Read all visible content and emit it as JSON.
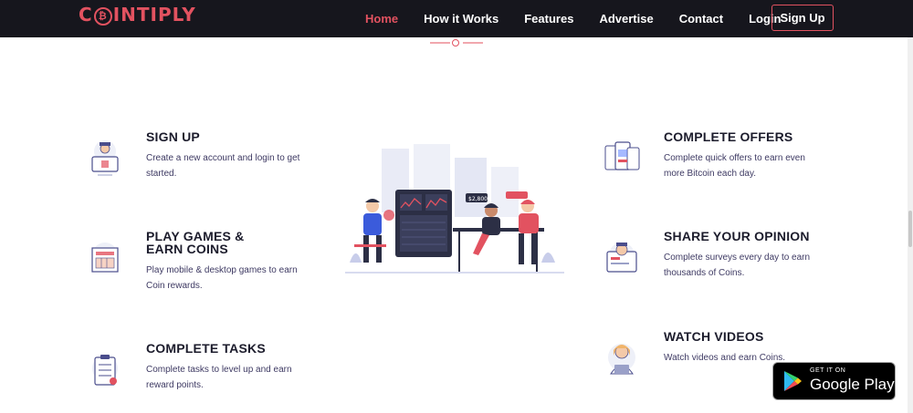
{
  "brand": {
    "name_pre": "C",
    "name_post": "INTIPLY",
    "coin_symbol": "₿"
  },
  "nav": {
    "items": [
      "Home",
      "How it Works",
      "Features",
      "Advertise",
      "Contact",
      "Login"
    ],
    "signup": "Sign Up"
  },
  "features_left": [
    {
      "title": "SIGN UP",
      "desc": "Create a new account and login to get started."
    },
    {
      "title": "PLAY GAMES & EARN COINS",
      "desc": "Play mobile & desktop games to earn Coin rewards."
    },
    {
      "title": "COMPLETE TASKS",
      "desc": "Complete tasks to level up and earn reward points."
    }
  ],
  "features_right": [
    {
      "title": "COMPLETE OFFERS",
      "desc": "Complete quick offers to earn even more Bitcoin each day."
    },
    {
      "title": "SHARE YOUR OPINION",
      "desc": "Complete surveys every day to earn thousands of Coins."
    },
    {
      "title": "WATCH VIDEOS",
      "desc": "Watch videos and earn Coins."
    }
  ],
  "hero": {
    "price_tag": "$2,800"
  },
  "google_play": {
    "small": "GET IT ON",
    "big": "Google Play"
  },
  "colors": {
    "accent": "#e25260",
    "nav_bg": "#16161d",
    "text": "#3e3a63"
  }
}
